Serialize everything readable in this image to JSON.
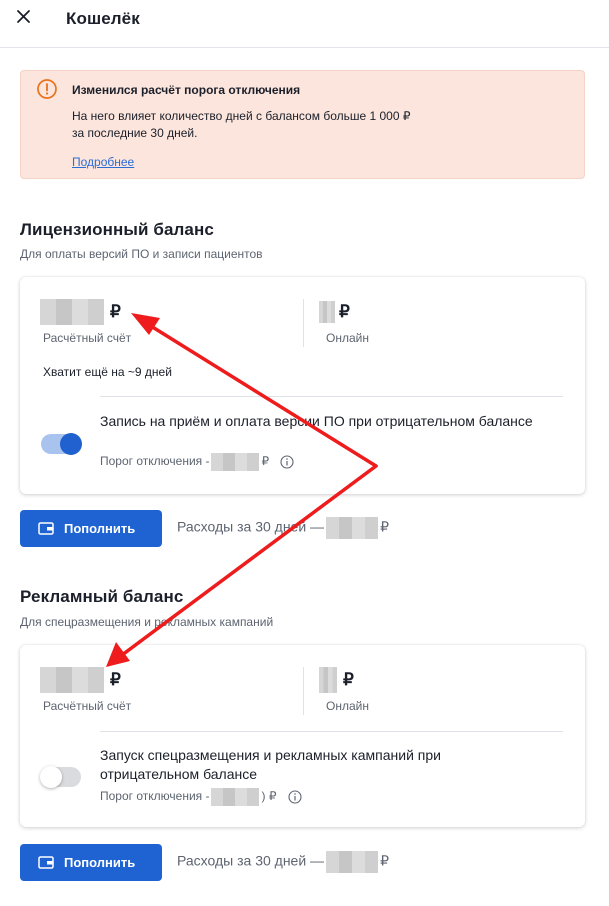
{
  "header": {
    "title": "Кошелёк",
    "close_icon": "close-icon"
  },
  "alert": {
    "title": "Изменился расчёт порога отключения",
    "text_line1": "На него влияет количество дней с балансом больше 1 000 ₽",
    "text_line2": "за последние 30 дней.",
    "link": "Подробнее",
    "icon": "warning-circle-icon",
    "bg_color": "#fbe5dc",
    "icon_color": "#e8731c"
  },
  "license": {
    "title": "Лицензионный баланс",
    "subtitle": "Для оплаты версий ПО и записи пациентов",
    "account_currency": "₽",
    "account_label": "Расчётный счёт",
    "online_currency": "₽",
    "online_label": "Онлайн",
    "enough_text": "Хватит ещё на ~9 дней",
    "toggle_on": true,
    "toggle_text": "Запись на приём и оплата версии ПО при отрицательном балансе",
    "threshold_prefix": "Порог отключения -",
    "threshold_currency": "₽",
    "topup_label": "Пополнить",
    "expenses_prefix": "Расходы за 30 дней —",
    "expenses_currency": "₽"
  },
  "ads": {
    "title": "Рекламный баланс",
    "subtitle": "Для спецразмещения и рекламных кампаний",
    "account_currency": "₽",
    "account_label": "Расчётный счёт",
    "online_currency": "₽",
    "online_label": "Онлайн",
    "toggle_on": false,
    "toggle_text": "Запуск спецразмещения и рекламных кампаний при отрицательном балансе",
    "threshold_prefix": "Порог отключения -",
    "threshold_currency": ") ₽",
    "topup_label": "Пополнить",
    "expenses_prefix": "Расходы за 30 дней —",
    "expenses_currency": "₽"
  },
  "colors": {
    "primary": "#1f63d3",
    "arrow": "#ee1c1c"
  }
}
